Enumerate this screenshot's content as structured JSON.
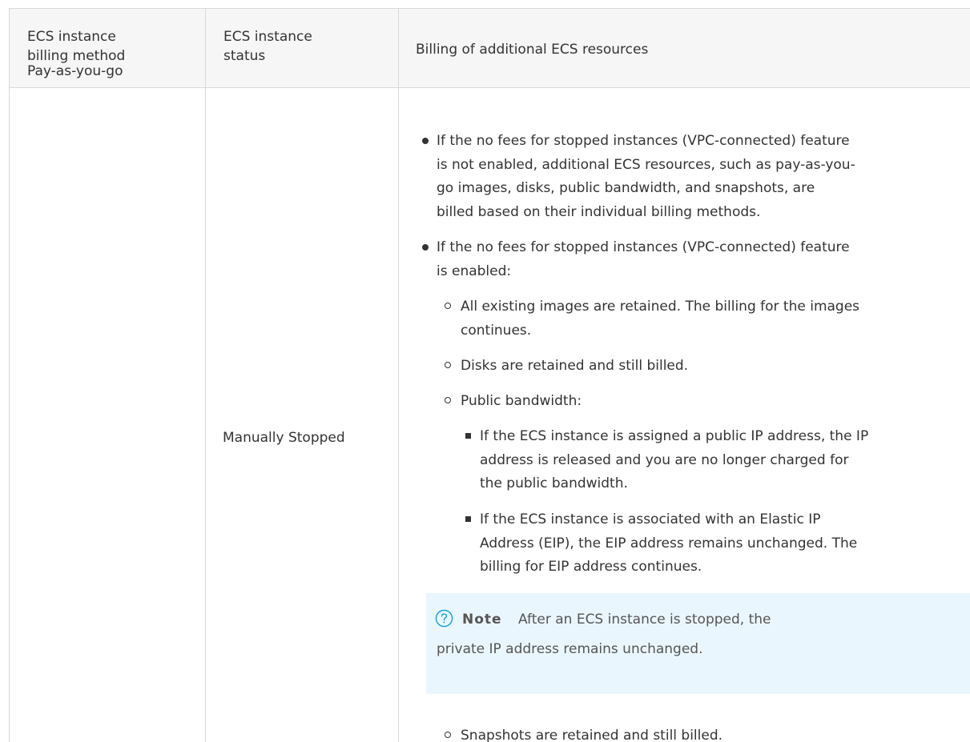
{
  "table": {
    "headers": {
      "billing_method": [
        "ECS instance",
        "billing method",
        "Pay-as-you-go"
      ],
      "instance_status": [
        "ECS instance",
        "status"
      ],
      "additional_billing": "Billing of additional ECS resources"
    },
    "row": {
      "status": "Manually Stopped",
      "bullets": {
        "first": [
          "If the no fees for stopped instances (VPC-connected) feature",
          "is not enabled, additional ECS resources, such as pay-as-you-",
          "go images, disks, public bandwidth, and snapshots, are",
          "billed based on their individual billing methods."
        ],
        "second": [
          "If the no fees for stopped instances (VPC-connected) feature",
          "is enabled:"
        ],
        "images": [
          "All existing images are retained. The billing for the images",
          "continues."
        ],
        "disks": "Disks are retained and still billed.",
        "bandwidth": "Public bandwidth:",
        "public_ip": [
          "If the ECS instance is assigned a public IP address, the IP",
          "address is released and you are no longer charged for",
          "the public bandwidth."
        ],
        "eip": [
          "If the ECS instance is associated with an Elastic IP",
          "Address (EIP), the EIP address remains unchanged. The",
          "billing for EIP address continues."
        ],
        "snapshots": "Snapshots are retained and still billed."
      },
      "note": {
        "icon": "question-circle-icon",
        "label": "Note",
        "text": [
          "After an ECS instance is stopped, the",
          "private IP address remains unchanged."
        ],
        "accent_color": "#00a1d6",
        "background_color": "#eaf6fd"
      }
    }
  }
}
